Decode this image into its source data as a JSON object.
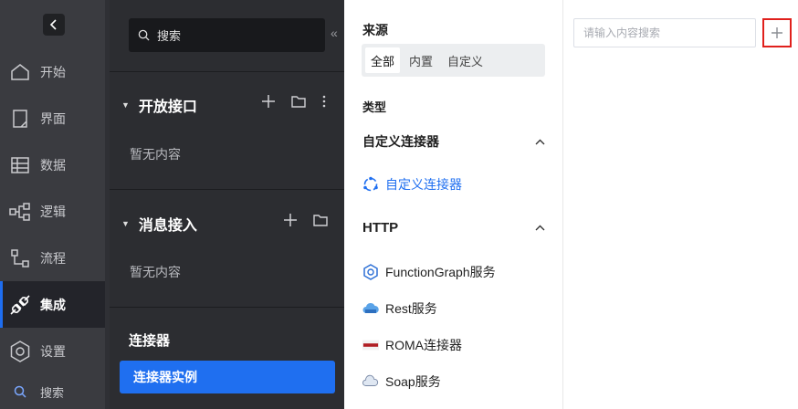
{
  "sidebar": {
    "collapse_icon": "chevron-left-icon",
    "items": [
      {
        "label": "开始",
        "icon": "home-icon"
      },
      {
        "label": "界面",
        "icon": "page-icon"
      },
      {
        "label": "数据",
        "icon": "table-icon"
      },
      {
        "label": "逻辑",
        "icon": "logic-icon"
      },
      {
        "label": "流程",
        "icon": "flow-icon"
      },
      {
        "label": "集成",
        "icon": "plug-icon",
        "active": true
      },
      {
        "label": "设置",
        "icon": "settings-icon"
      },
      {
        "label": "搜索",
        "icon": "search-icon"
      }
    ]
  },
  "panel": {
    "search_label": "搜索",
    "sections": [
      {
        "title": "开放接口",
        "empty": "暂无内容"
      },
      {
        "title": "消息接入",
        "empty": "暂无内容"
      }
    ],
    "connector_title": "连接器",
    "connector_instance": "连接器实例"
  },
  "mid": {
    "source_label": "来源",
    "source_tabs": [
      "全部",
      "内置",
      "自定义"
    ],
    "type_label": "类型",
    "groups": [
      {
        "title": "自定义连接器",
        "items": [
          "自定义连接器"
        ]
      },
      {
        "title": "HTTP",
        "items": [
          "FunctionGraph服务",
          "Rest服务",
          "ROMA连接器",
          "Soap服务"
        ]
      }
    ]
  },
  "right": {
    "search_placeholder": "请输入内容搜索"
  },
  "colors": {
    "accent": "#1f6ff0",
    "highlight_border": "#e0201c"
  }
}
